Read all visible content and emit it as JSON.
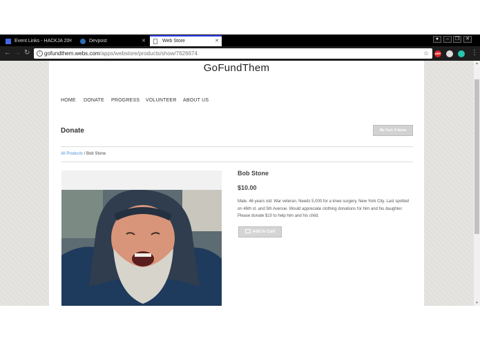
{
  "browser": {
    "tabs": [
      {
        "title": "Event Links - HACKJA 20",
        "icon": "calendar-icon"
      },
      {
        "title": "Devpost",
        "icon": "devpost-icon"
      },
      {
        "title": "Web Store",
        "icon": "page-icon"
      }
    ],
    "address": {
      "domain": "gofundthem.webs.com",
      "path": "/apps/webstore/products/show/7626674"
    },
    "extensions": [
      {
        "name": "adblock-icon",
        "label": "ABP",
        "color": "#d9262a"
      },
      {
        "name": "drive-icon",
        "label": "",
        "color": "#dddddd"
      },
      {
        "name": "circle-extension-icon",
        "label": "",
        "color": "#26c6b0"
      }
    ]
  },
  "site": {
    "title": "GoFundThem",
    "nav": [
      "HOME",
      "DONATE",
      "PROGRESS",
      "VOLUNTEER",
      "ABOUT US"
    ]
  },
  "page": {
    "heading": "Donate",
    "cart_button": "My Cart: 0 items",
    "breadcrumb": {
      "link": "All Products",
      "separator": "/",
      "current": "Bob Stone"
    }
  },
  "product": {
    "name": "Bob Stone",
    "price": "$10.00",
    "description": "Male. 46 years old. War veteran. Needs 5,000 for a knee surgery. New York City. Last spotted on 46th st. and 5th Avenue. Would appreciate clothing donations for him and his daughter. Please donate $10 to help him and his child.",
    "add_button": "Add to Cart"
  },
  "colors": {
    "link": "#4a90d9",
    "tab_accent": "#3b4cff"
  }
}
